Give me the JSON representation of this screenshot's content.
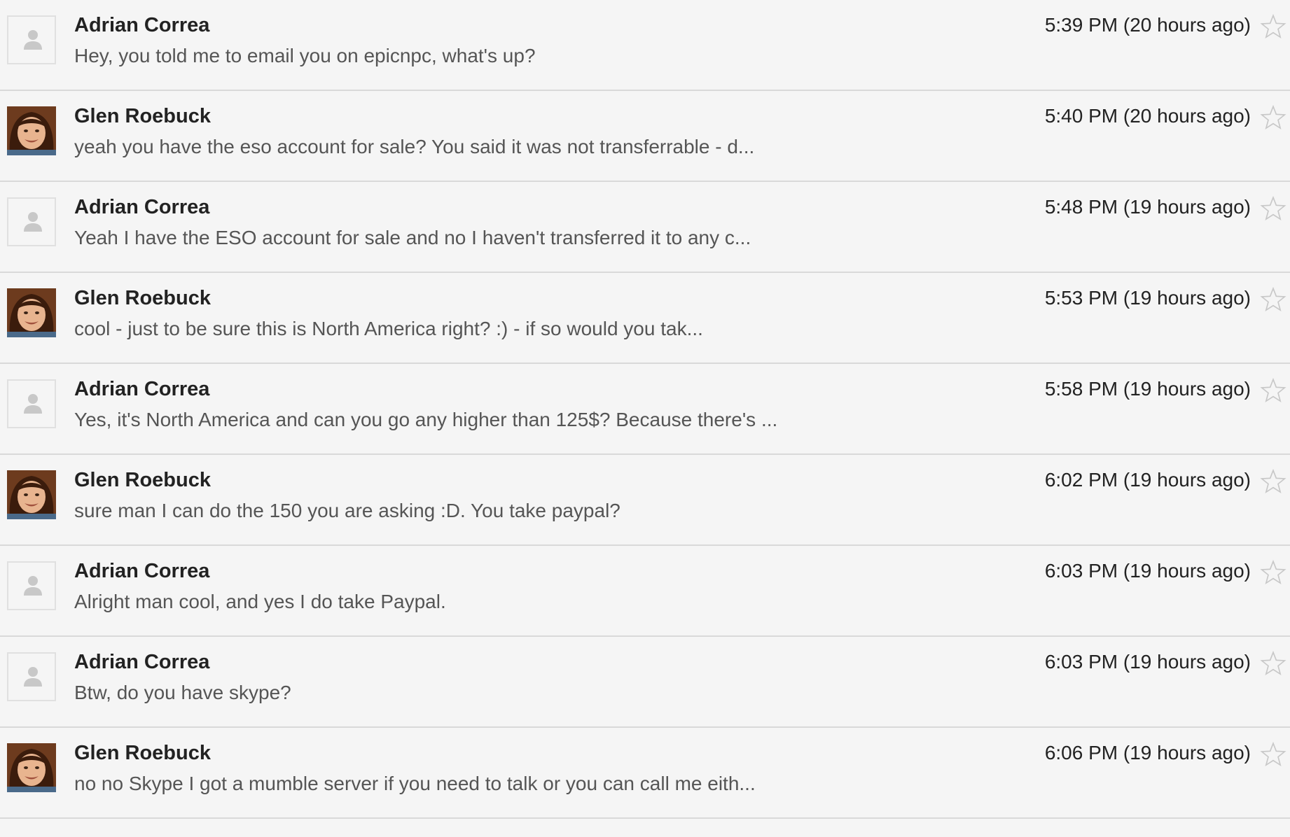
{
  "messages": [
    {
      "sender": "Adrian Correa",
      "avatar": "default-person-icon",
      "snippet": "Hey, you told me to email you on epicnpc, what's up?",
      "time": "5:39 PM (20 hours ago)"
    },
    {
      "sender": "Glen Roebuck",
      "avatar": "profile-photo",
      "snippet": "yeah you have the eso account for sale? You said it was not transferrable - d...",
      "time": "5:40 PM (20 hours ago)"
    },
    {
      "sender": "Adrian Correa",
      "avatar": "default-person-icon",
      "snippet": "Yeah I have the ESO account for sale and no I haven't transferred it to any c...",
      "time": "5:48 PM (19 hours ago)"
    },
    {
      "sender": "Glen Roebuck",
      "avatar": "profile-photo",
      "snippet": "cool - just to be sure this is North America right? :) - if so would you tak...",
      "time": "5:53 PM (19 hours ago)"
    },
    {
      "sender": "Adrian Correa",
      "avatar": "default-person-icon",
      "snippet": "Yes, it's North America and can you go any higher than 125$? Because there's ...",
      "time": "5:58 PM (19 hours ago)"
    },
    {
      "sender": "Glen Roebuck",
      "avatar": "profile-photo",
      "snippet": "sure man I can do the 150 you are asking :D. You take paypal?",
      "time": "6:02 PM (19 hours ago)"
    },
    {
      "sender": "Adrian Correa",
      "avatar": "default-person-icon",
      "snippet": "Alright man cool, and yes I do take Paypal.",
      "time": "6:03 PM (19 hours ago)"
    },
    {
      "sender": "Adrian Correa",
      "avatar": "default-person-icon",
      "snippet": "Btw, do you have skype?",
      "time": "6:03 PM (19 hours ago)"
    },
    {
      "sender": "Glen Roebuck",
      "avatar": "profile-photo",
      "snippet": "no no Skype I got a mumble server if you need to talk or you can call me eith...",
      "time": "6:06 PM (19 hours ago)"
    }
  ],
  "icons": {
    "star": "star-outline-icon"
  },
  "colors": {
    "background": "#f5f5f5",
    "divider": "#d9d9d9",
    "sender_text": "#222222",
    "snippet_text": "#555555",
    "star_outline": "#c8c8c8"
  }
}
